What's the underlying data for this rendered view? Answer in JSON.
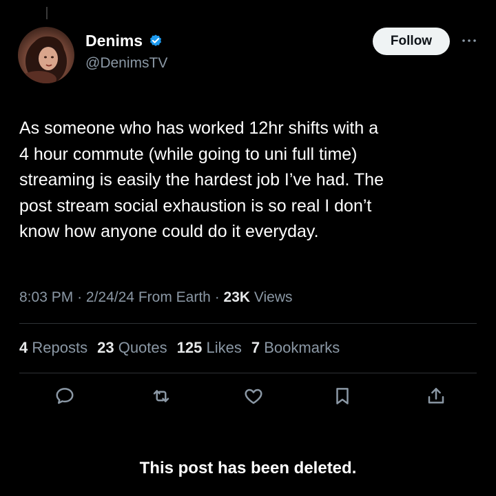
{
  "author": {
    "display_name": "Denims",
    "handle": "@DenimsTV",
    "verified_icon": "verified-badge-icon",
    "avatar": "user-avatar"
  },
  "header": {
    "follow_label": "Follow",
    "more_icon": "more-options-icon"
  },
  "post": {
    "text": "As someone who has worked 12hr shifts with a\n4 hour commute (while going to uni full time)\nstreaming is easily the hardest job I’ve had. The\npost stream social exhaustion is so real I don’t\nknow how anyone could do it everyday.",
    "time": "8:03 PM",
    "date": "2/24/24",
    "location": "From Earth",
    "views_count": "23K",
    "views_label": "Views"
  },
  "stats": {
    "reposts_count": "4",
    "reposts_label": "Reposts",
    "quotes_count": "23",
    "quotes_label": "Quotes",
    "likes_count": "125",
    "likes_label": "Likes",
    "bookmarks_count": "7",
    "bookmarks_label": "Bookmarks"
  },
  "actions": [
    "reply-icon",
    "repost-icon",
    "like-icon",
    "bookmark-icon",
    "share-icon"
  ],
  "notice": "This post has been deleted.",
  "colors": {
    "background": "#000000",
    "text_primary": "#ffffff",
    "text_secondary": "#8b98a5",
    "verified_blue": "#1d9bf0",
    "divider": "#2f3336"
  }
}
